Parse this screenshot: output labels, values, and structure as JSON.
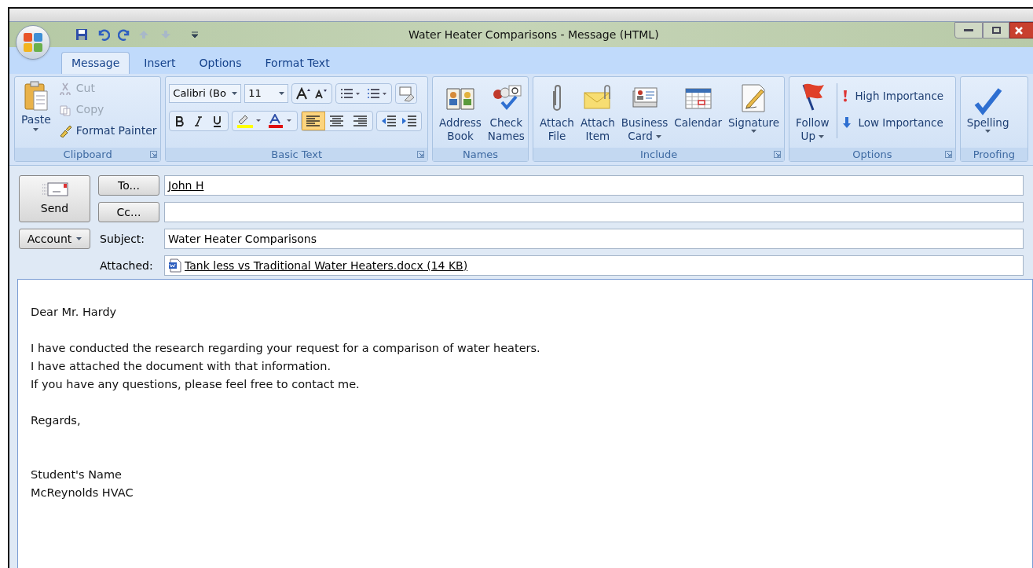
{
  "window": {
    "title": "Water Heater Comparisons - Message (HTML)"
  },
  "tabs": [
    {
      "label": "Message",
      "selected": true
    },
    {
      "label": "Insert",
      "selected": false
    },
    {
      "label": "Options",
      "selected": false
    },
    {
      "label": "Format Text",
      "selected": false
    }
  ],
  "ribbon": {
    "clipboard": {
      "title": "Clipboard",
      "paste": "Paste",
      "cut": {
        "label": "Cut",
        "disabled": true
      },
      "copy": {
        "label": "Copy",
        "disabled": true
      },
      "format_painter": {
        "label": "Format Painter",
        "disabled": false
      }
    },
    "basic_text": {
      "title": "Basic Text",
      "font": "Calibri (Bo",
      "size": "11",
      "align": [
        {
          "selected": true
        },
        {
          "selected": false
        },
        {
          "selected": false
        }
      ]
    },
    "names": {
      "title": "Names",
      "buttons": [
        {
          "kind": "address",
          "lines": [
            "Address",
            "Book"
          ]
        },
        {
          "kind": "check",
          "lines": [
            "Check",
            "Names"
          ]
        }
      ]
    },
    "include": {
      "title": "Include",
      "buttons": [
        {
          "kind": "clip",
          "lines": [
            "Attach",
            "File"
          ],
          "dropdown": false
        },
        {
          "kind": "envelope",
          "lines": [
            "Attach",
            "Item"
          ],
          "dropdown": false
        },
        {
          "kind": "card",
          "lines": [
            "Business",
            "Card"
          ],
          "dropdown": true
        },
        {
          "kind": "calendar",
          "lines": [
            "Calendar"
          ],
          "dropdown": false
        },
        {
          "kind": "signature",
          "lines": [
            "Signature"
          ],
          "dropdown": true
        }
      ]
    },
    "options": {
      "title": "Options",
      "follow_up": [
        "Follow",
        "Up"
      ],
      "high": "High Importance",
      "low": "Low Importance"
    },
    "proofing": {
      "title": "Proofing",
      "spelling": "Spelling"
    }
  },
  "header": {
    "send": "Send",
    "account": "Account",
    "to": {
      "button": "To...",
      "value": "John H"
    },
    "cc": {
      "button": "Cc..."
    },
    "subject": {
      "label": "Subject:",
      "value": "Water Heater Comparisons"
    },
    "attached": {
      "label": "Attached:",
      "file": "Tank less vs Traditional Water Heaters.docx (14 KB)"
    }
  },
  "body": {
    "greeting": "Dear Mr. Hardy",
    "lines": [
      "I have conducted the research regarding your request for a comparison of water heaters.",
      "I have attached the document with that information.",
      "If you have any questions, please feel free to contact me."
    ],
    "closing": "Regards,",
    "signature": [
      "Student's Name",
      "McReynolds HVAC"
    ]
  }
}
